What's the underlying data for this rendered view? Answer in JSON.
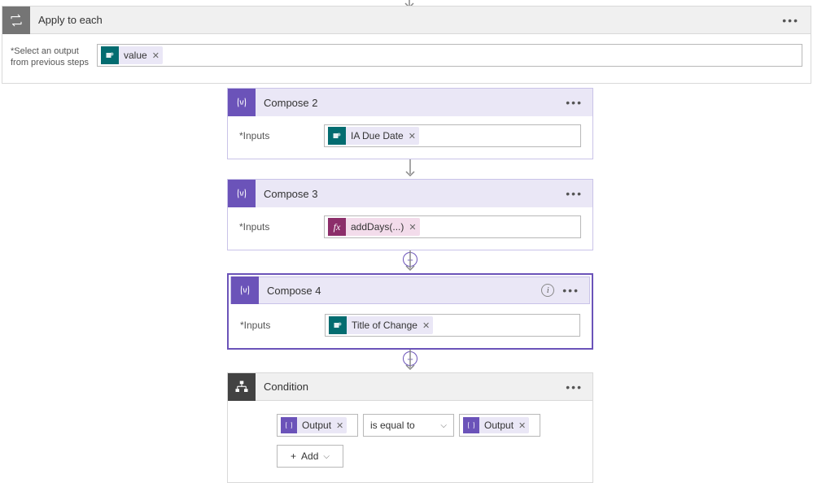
{
  "outer": {
    "title": "Apply to each",
    "select_label_line1": "*Select an output",
    "select_label_line2": "from previous steps",
    "token_value": "value"
  },
  "cards": {
    "compose2": {
      "title": "Compose 2",
      "label": "*Inputs",
      "token": "IA Due Date"
    },
    "compose3": {
      "title": "Compose 3",
      "label": "*Inputs",
      "token": "addDays(...)"
    },
    "compose4": {
      "title": "Compose 4",
      "label": "*Inputs",
      "token": "Title of Change"
    }
  },
  "condition": {
    "title": "Condition",
    "left_token": "Output",
    "operator": "is equal to",
    "right_token": "Output",
    "add_label": "Add"
  }
}
